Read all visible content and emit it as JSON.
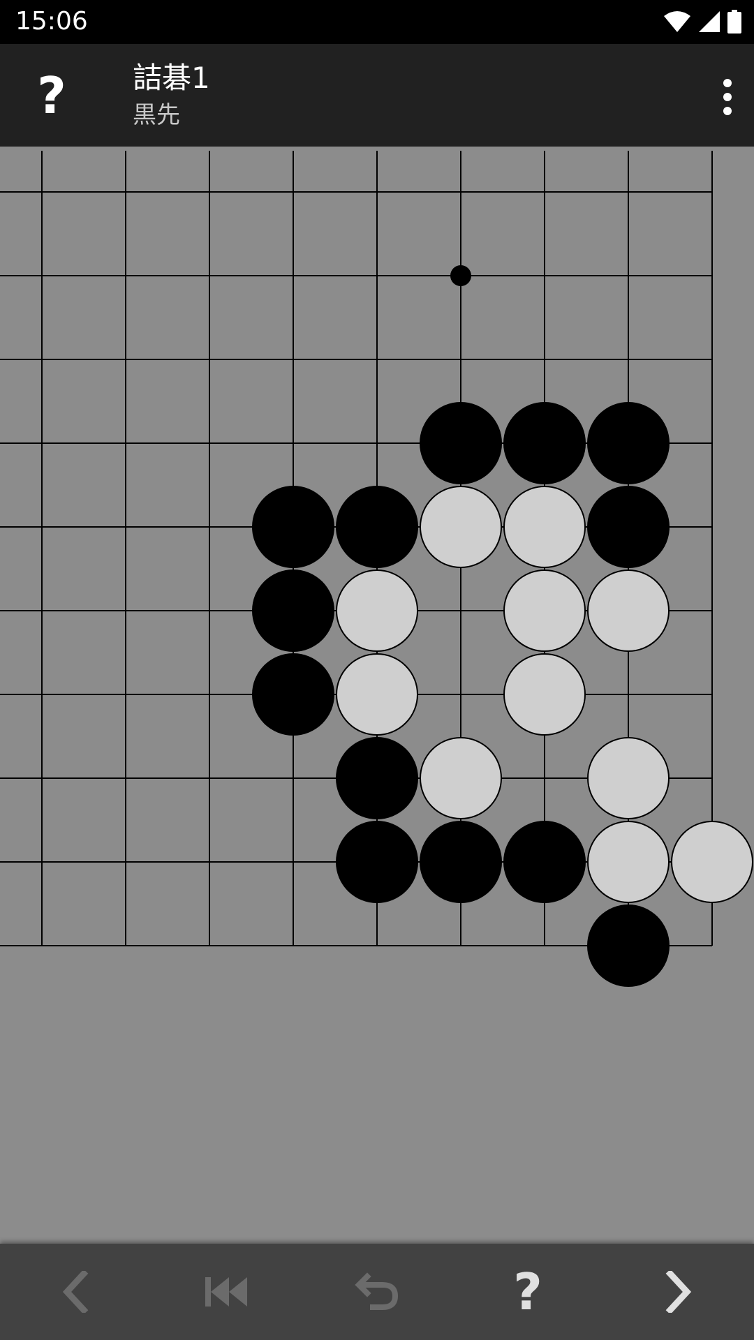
{
  "status_bar": {
    "time": "15:06",
    "icons": [
      "wifi-icon",
      "cellular-signal-icon",
      "battery-icon"
    ]
  },
  "app_bar": {
    "help_icon": "?",
    "title": "詰碁1",
    "subtitle": "黒先",
    "menu_icon": "more-vert-icon"
  },
  "board": {
    "line_color": "#000000",
    "background": "#8c8c8c",
    "black_stone_color": "#000000",
    "white_stone_color": "#cfcfcf",
    "star_points": [
      [
        5,
        1
      ]
    ],
    "black_stones": [
      [
        5,
        3
      ],
      [
        6,
        3
      ],
      [
        7,
        3
      ],
      [
        3,
        4
      ],
      [
        4,
        4
      ],
      [
        7,
        4
      ],
      [
        3,
        5
      ],
      [
        3,
        6
      ],
      [
        4,
        7
      ],
      [
        4,
        8
      ],
      [
        5,
        8
      ],
      [
        6,
        8
      ],
      [
        7,
        9
      ]
    ],
    "white_stones": [
      [
        5,
        4
      ],
      [
        6,
        4
      ],
      [
        4,
        5
      ],
      [
        6,
        5
      ],
      [
        7,
        5
      ],
      [
        4,
        6
      ],
      [
        6,
        6
      ],
      [
        5,
        7
      ],
      [
        7,
        7
      ],
      [
        7,
        8
      ],
      [
        8,
        8
      ]
    ]
  },
  "bottom_bar": {
    "buttons": [
      {
        "name": "previous-button",
        "icon": "chevron-left-icon",
        "enabled": false
      },
      {
        "name": "rewind-button",
        "icon": "skip-to-start-icon",
        "enabled": false
      },
      {
        "name": "undo-button",
        "icon": "undo-icon",
        "enabled": false
      },
      {
        "name": "hint-button",
        "icon": "help-icon",
        "label": "?",
        "enabled": true
      },
      {
        "name": "next-button",
        "icon": "chevron-right-icon",
        "enabled": true
      }
    ],
    "enabled_color": "#e0e0e0",
    "disabled_color": "#6b6b6b"
  }
}
